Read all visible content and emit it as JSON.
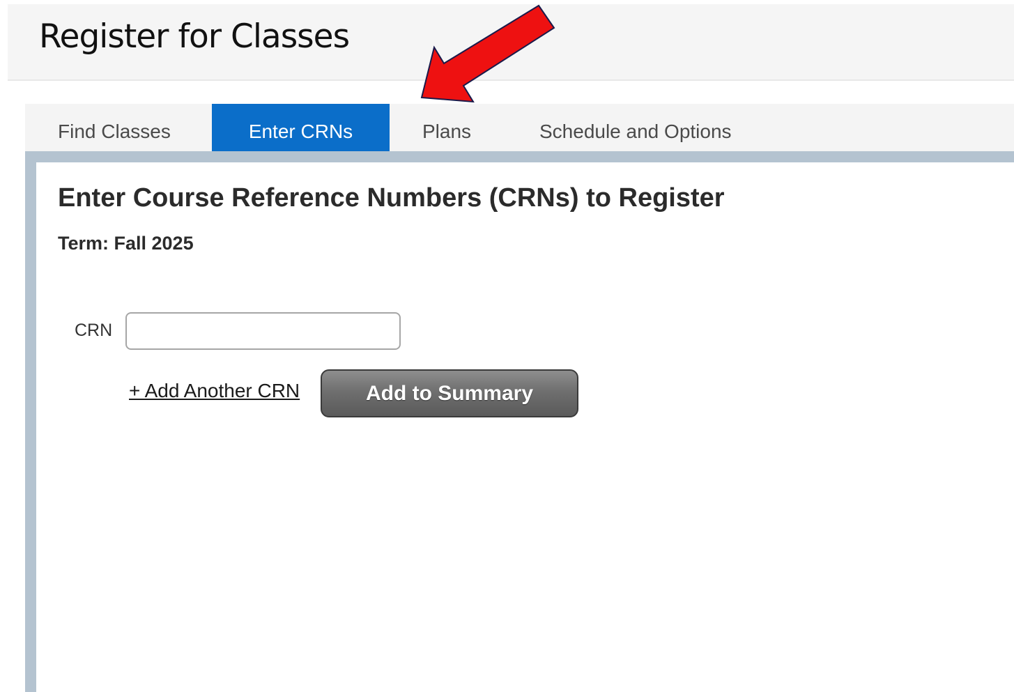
{
  "header": {
    "title": "Register for Classes"
  },
  "tabs": [
    {
      "label": "Find Classes",
      "active": false
    },
    {
      "label": "Enter CRNs",
      "active": true
    },
    {
      "label": "Plans",
      "active": false
    },
    {
      "label": "Schedule and Options",
      "active": false
    }
  ],
  "main": {
    "section_title": "Enter Course Reference Numbers (CRNs) to Register",
    "term": "Term: Fall 2025",
    "crn_label": "CRN",
    "crn_value": "",
    "add_link": "+ Add Another CRN",
    "submit_label": "Add to Summary"
  },
  "colors": {
    "active_tab": "#0b6ec9",
    "tab_rule": "#b4c3d0",
    "annotation_arrow": "#ee1111"
  },
  "annotation": {
    "icon": "red-arrow-icon",
    "points_to": "tab-plans"
  }
}
